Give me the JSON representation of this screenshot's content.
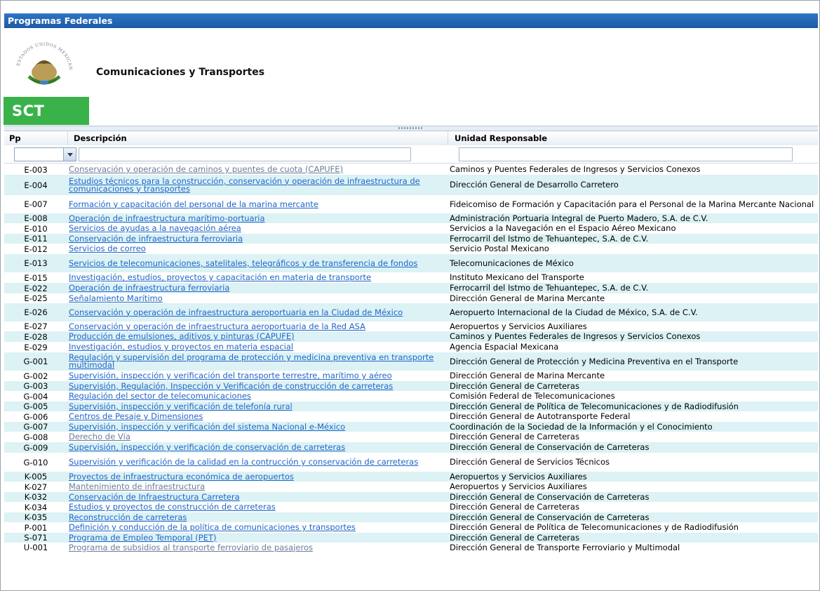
{
  "window": {
    "title": "Programas Federales"
  },
  "header": {
    "agency_name": "Comunicaciones y Transportes",
    "logo_text": "SCT",
    "seal_text": "ESTADOS UNIDOS MEXICANOS"
  },
  "table": {
    "columns": [
      "Pp",
      "Descripción",
      "Unidad Responsable"
    ],
    "rows": [
      {
        "pp": "E-003",
        "desc": "Conservación y operación de caminos y puentes de cuota (CAPUFE)",
        "unit": "Caminos y Puentes Federales de Ingresos y Servicios Conexos"
      },
      {
        "pp": "E-004",
        "desc": "Estudios técnicos para la construcción, conservación y operación de infraestructura de comunicaciones y transportes",
        "unit": "Dirección General de Desarrollo Carretero"
      },
      {
        "pp": "E-007",
        "desc": "Formación y capacitación del personal de la marina mercante",
        "unit": "Fideicomiso de Formación y Capacitación para el Personal de la Marina Mercante Nacional"
      },
      {
        "pp": "E-008",
        "desc": "Operación de infraestructura marítimo-portuaria",
        "unit": "Administración Portuaria Integral de Puerto Madero, S.A. de C.V."
      },
      {
        "pp": "E-010",
        "desc": "Servicios de ayudas a la navegación aérea",
        "unit": "Servicios a la Navegación en el Espacio Aéreo Mexicano"
      },
      {
        "pp": "E-011",
        "desc": "Conservación de infraestructura ferroviaria",
        "unit": "Ferrocarril del Istmo de Tehuantepec, S.A. de C.V."
      },
      {
        "pp": "E-012",
        "desc": "Servicios de correo",
        "unit": "Servicio Postal Mexicano"
      },
      {
        "pp": "E-013",
        "desc": "Servicios de telecomunicaciones, satelitales, telegráficos y de transferencia de fondos",
        "unit": "Telecomunicaciones de México"
      },
      {
        "pp": "E-015",
        "desc": "Investigación, estudios, proyectos y capacitación en materia de transporte",
        "unit": "Instituto Mexicano del Transporte"
      },
      {
        "pp": "E-022",
        "desc": "Operación de infraestructura ferroviaria",
        "unit": "Ferrocarril del Istmo de Tehuantepec, S.A. de C.V."
      },
      {
        "pp": "E-025",
        "desc": "Señalamiento Marítimo",
        "unit": "Dirección General de Marina Mercante"
      },
      {
        "pp": "E-026",
        "desc": "Conservación y operación de infraestructura aeroportuaria en la Ciudad de México",
        "unit": "Aeropuerto Internacional de la Ciudad de México, S.A. de C.V."
      },
      {
        "pp": "E-027",
        "desc": "Conservación y operación de infraestructura aeroportuaria de la Red ASA",
        "unit": "Aeropuertos y Servicios Auxiliares"
      },
      {
        "pp": "E-028",
        "desc": "Producción de emulsiones, aditivos y pinturas (CAPUFE)",
        "unit": "Caminos y Puentes Federales de Ingresos y Servicios Conexos"
      },
      {
        "pp": "E-029",
        "desc": "Investigación, estudios y proyectos en materia espacial",
        "unit": "Agencia Espacial Mexicana"
      },
      {
        "pp": "G-001",
        "desc": "Regulación y supervisión del programa de protección y medicina preventiva en transporte multimodal",
        "unit": "Dirección General de Protección y Medicina Preventiva en el Transporte"
      },
      {
        "pp": "G-002",
        "desc": "Supervisión, inspección y verificación del transporte terrestre, marítimo y aéreo",
        "unit": "Dirección General de Marina Mercante"
      },
      {
        "pp": "G-003",
        "desc": "Supervisión, Regulación, Inspección y Verificación de construcción de carreteras",
        "unit": "Dirección General de Carreteras"
      },
      {
        "pp": "G-004",
        "desc": "Regulación del sector de telecomunicaciones",
        "unit": "Comisión Federal de Telecomunicaciones"
      },
      {
        "pp": "G-005",
        "desc": "Supervisión, inspección y verificación de telefonía rural",
        "unit": "Dirección General de Política de Telecomunicaciones y de Radiodifusión"
      },
      {
        "pp": "G-006",
        "desc": "Centros de Pesaje y Dimensiones",
        "unit": "Dirección General de Autotransporte Federal"
      },
      {
        "pp": "G-007",
        "desc": "Supervisión, inspección y verificación del sistema Nacional e-México",
        "unit": "Coordinación de la Sociedad de la Información y el Conocimiento"
      },
      {
        "pp": "G-008",
        "desc": "Derecho de Vía",
        "unit": "Dirección General de Carreteras"
      },
      {
        "pp": "G-009",
        "desc": "Supervisión, inspección y verificación de conservación de carreteras",
        "unit": "Dirección General de Conservación de Carreteras"
      },
      {
        "pp": "G-010",
        "desc": "Supervisión y verificación de la calidad en la contrucción y conservación de carreteras",
        "unit": "Dirección General de Servicios Técnicos"
      },
      {
        "pp": "K-005",
        "desc": "Proyectos de infraestructura económica de aeropuertos",
        "unit": "Aeropuertos y Servicios Auxiliares"
      },
      {
        "pp": "K-027",
        "desc": "Mantenimiento de infraestructura",
        "unit": "Aeropuertos y Servicios Auxiliares"
      },
      {
        "pp": "K-032",
        "desc": "Conservación de Infraestructura Carretera",
        "unit": "Dirección General de Conservación de Carreteras"
      },
      {
        "pp": "K-034",
        "desc": "Estudios y proyectos de construcción de carreteras",
        "unit": "Dirección General de Carreteras"
      },
      {
        "pp": "K-035",
        "desc": "Reconstrucción de carreteras",
        "unit": "Dirección General de Conservación de Carreteras"
      },
      {
        "pp": "P-001",
        "desc": "Definición y conducción de la política de comunicaciones y transportes",
        "unit": "Dirección General de Política de Telecomunicaciones y de Radiodifusión"
      },
      {
        "pp": "S-071",
        "desc": "Programa de Empleo Temporal (PET)",
        "unit": "Dirección General de Carreteras"
      },
      {
        "pp": "U-001",
        "desc": "Programa de subsidios al transporte ferroviario de pasajeros",
        "unit": "Dirección General de Transporte Ferroviario y Multimodal"
      }
    ]
  },
  "colors": {
    "title_bar": "#1c5aa6",
    "link": "#1f66c9",
    "visited_link": "#6b7d99",
    "row_alt": "#dcf2f5",
    "logo_green": "#39b24a"
  }
}
